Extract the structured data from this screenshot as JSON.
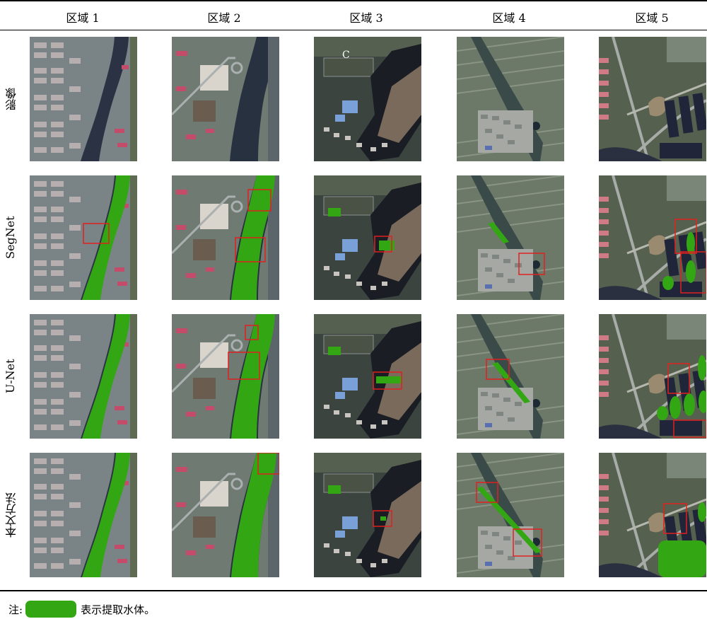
{
  "columns": [
    "区域 1",
    "区域 2",
    "区域 3",
    "区域 4",
    "区域 5"
  ],
  "rows": [
    "影像",
    "SegNet",
    "U-Net",
    "本文方法"
  ],
  "cell_annotation": "C",
  "note": {
    "prefix": "注:",
    "legend_text": "表示提取水体。"
  },
  "colors": {
    "water_mask": "#33a614",
    "highlight_box": "#e0201f"
  }
}
